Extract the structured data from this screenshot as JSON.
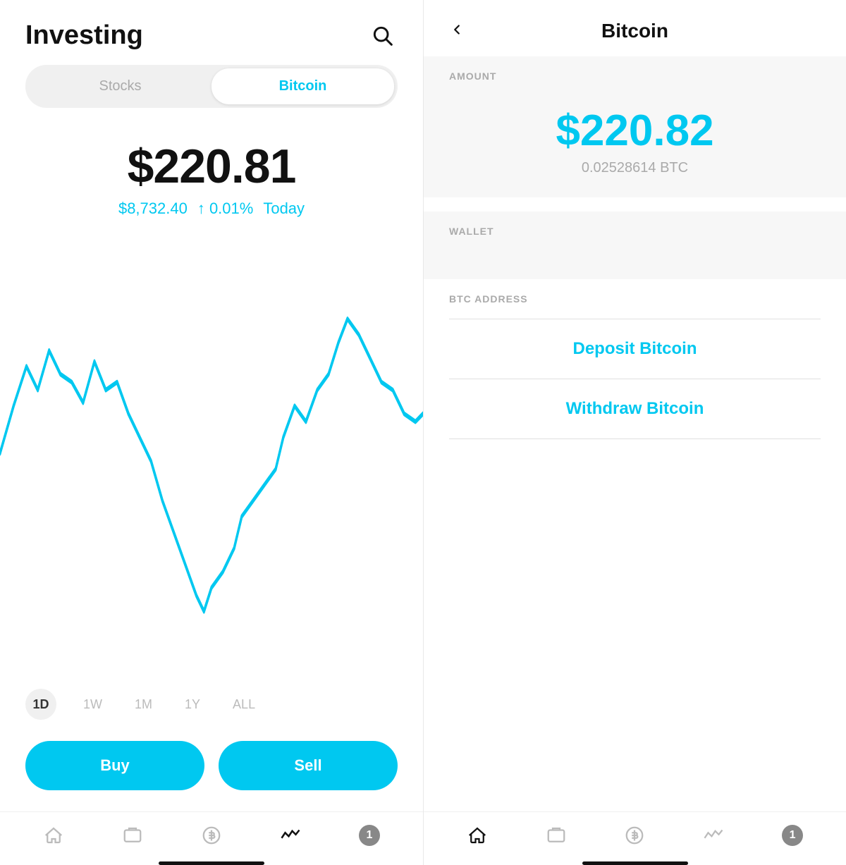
{
  "left": {
    "title": "Investing",
    "tabs": [
      {
        "label": "Stocks",
        "active": false
      },
      {
        "label": "Bitcoin",
        "active": true
      }
    ],
    "price": {
      "main": "$220.81",
      "btc_price": "$8,732.40",
      "change": "↑ 0.01%",
      "period": "Today"
    },
    "time_filters": [
      "1D",
      "1W",
      "1M",
      "1Y",
      "ALL"
    ],
    "active_filter": "1D",
    "buttons": {
      "buy": "Buy",
      "sell": "Sell"
    },
    "nav": {
      "home": "⌂",
      "tv": "⬜",
      "dollar": "$",
      "activity": "~",
      "badge": "1"
    }
  },
  "right": {
    "back": "<",
    "title": "Bitcoin",
    "amount_label": "AMOUNT",
    "amount_value": "$220.82",
    "amount_btc": "0.02528614 BTC",
    "wallet_label": "WALLET",
    "btc_address_label": "BTC ADDRESS",
    "deposit_label": "Deposit Bitcoin",
    "withdraw_label": "Withdraw Bitcoin",
    "nav": {
      "home": "⌂",
      "tv": "⬜",
      "dollar": "$",
      "activity": "~",
      "badge": "1"
    }
  }
}
